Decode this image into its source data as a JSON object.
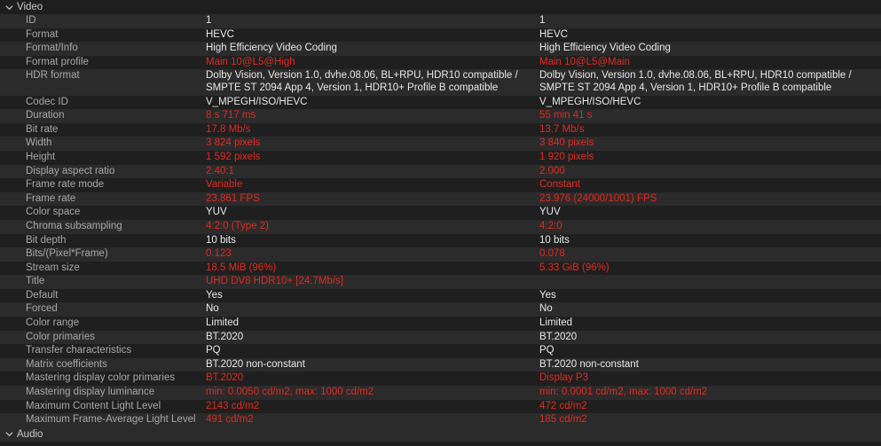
{
  "sections": {
    "video_label": "Video",
    "audio_label": "Audio"
  },
  "rows": [
    {
      "label": "ID",
      "v1": "1",
      "v2": "1",
      "diff": false
    },
    {
      "label": "Format",
      "v1": "HEVC",
      "v2": "HEVC",
      "diff": false
    },
    {
      "label": "Format/Info",
      "v1": "High Efficiency Video Coding",
      "v2": "High Efficiency Video Coding",
      "diff": false
    },
    {
      "label": "Format profile",
      "v1": "Main 10@L5@High",
      "v2": "Main 10@L5@Main",
      "diff": true
    },
    {
      "label": "HDR format",
      "v1": "Dolby Vision, Version 1.0, dvhe.08.06, BL+RPU, HDR10 compatible / SMPTE ST 2094 App 4, Version 1, HDR10+ Profile B compatible",
      "v2": "Dolby Vision, Version 1.0, dvhe.08.06, BL+RPU, HDR10 compatible / SMPTE ST 2094 App 4, Version 1, HDR10+ Profile B compatible",
      "diff": false
    },
    {
      "label": "Codec ID",
      "v1": "V_MPEGH/ISO/HEVC",
      "v2": "V_MPEGH/ISO/HEVC",
      "diff": false
    },
    {
      "label": "Duration",
      "v1": "8 s 717 ms",
      "v2": "55 min 41 s",
      "diff": true
    },
    {
      "label": "Bit rate",
      "v1": "17.8 Mb/s",
      "v2": "13.7 Mb/s",
      "diff": true
    },
    {
      "label": "Width",
      "v1": "3 824 pixels",
      "v2": "3 840 pixels",
      "diff": true
    },
    {
      "label": "Height",
      "v1": "1 592 pixels",
      "v2": "1 920 pixels",
      "diff": true
    },
    {
      "label": "Display aspect ratio",
      "v1": "2.40:1",
      "v2": "2.000",
      "diff": true
    },
    {
      "label": "Frame rate mode",
      "v1": "Variable",
      "v2": "Constant",
      "diff": true
    },
    {
      "label": "Frame rate",
      "v1": "23.861 FPS",
      "v2": "23.976 (24000/1001) FPS",
      "diff": true
    },
    {
      "label": "Color space",
      "v1": "YUV",
      "v2": "YUV",
      "diff": false
    },
    {
      "label": "Chroma subsampling",
      "v1": "4:2:0 (Type 2)",
      "v2": "4:2:0",
      "diff": true
    },
    {
      "label": "Bit depth",
      "v1": "10 bits",
      "v2": "10 bits",
      "diff": false
    },
    {
      "label": "Bits/(Pixel*Frame)",
      "v1": "0.123",
      "v2": "0.078",
      "diff": true
    },
    {
      "label": "Stream size",
      "v1": "18.5 MiB (96%)",
      "v2": "5.33 GiB (96%)",
      "diff": true
    },
    {
      "label": "Title",
      "v1": "UHD DV8 HDR10+ [24.7Mb/s]",
      "v2": "",
      "diff": true
    },
    {
      "label": "Default",
      "v1": "Yes",
      "v2": "Yes",
      "diff": false
    },
    {
      "label": "Forced",
      "v1": "No",
      "v2": "No",
      "diff": false
    },
    {
      "label": "Color range",
      "v1": "Limited",
      "v2": "Limited",
      "diff": false
    },
    {
      "label": "Color primaries",
      "v1": "BT.2020",
      "v2": "BT.2020",
      "diff": false
    },
    {
      "label": "Transfer characteristics",
      "v1": "PQ",
      "v2": "PQ",
      "diff": false
    },
    {
      "label": "Matrix coefficients",
      "v1": "BT.2020 non-constant",
      "v2": "BT.2020 non-constant",
      "diff": false
    },
    {
      "label": "Mastering display color primaries",
      "v1": "BT.2020",
      "v2": "Display P3",
      "diff": true
    },
    {
      "label": "Mastering display luminance",
      "v1": "min: 0.0050 cd/m2, max: 1000 cd/m2",
      "v2": "min: 0.0001 cd/m2, max: 1000 cd/m2",
      "diff": true
    },
    {
      "label": "Maximum Content Light Level",
      "v1": "2143 cd/m2",
      "v2": "472 cd/m2",
      "diff": true
    },
    {
      "label": "Maximum Frame-Average Light Level",
      "v1": "491 cd/m2",
      "v2": "185 cd/m2",
      "diff": true
    }
  ],
  "colors": {
    "diff_text": "#e02b20",
    "same_text": "#e8e8e8",
    "label_text": "#a8a8a8",
    "row_odd": "#2b2b2b",
    "row_even": "#1f1f1f"
  }
}
